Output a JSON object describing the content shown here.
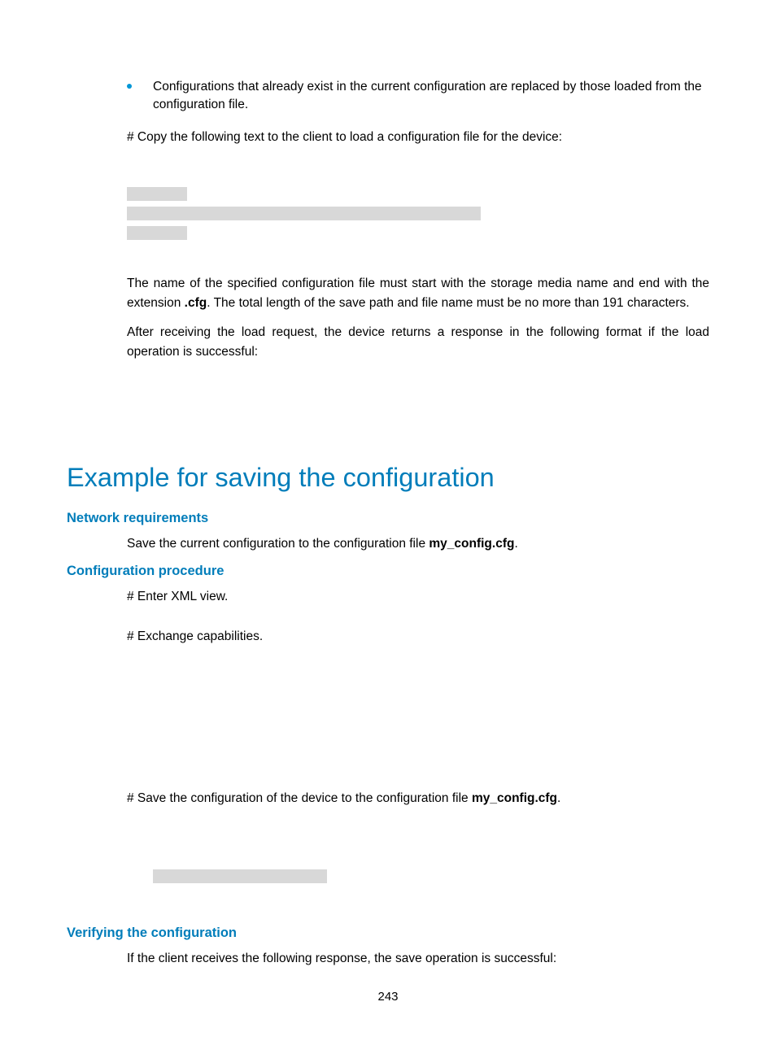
{
  "bullet": "Configurations that already exist in the current configuration are replaced by those loaded from the configuration file.",
  "copy_text": "# Copy the following text to the client to load a configuration file for the device:",
  "para_name_1": "The name of the specified configuration file must start with the storage media name and end with the extension ",
  "cfg_ext": ".cfg",
  "para_name_2": ". The total length of the save path and file name must be no more than 191 characters.",
  "para_after": "After receiving the load request, the device returns a response in the following format if the load operation is successful:",
  "heading_main": "Example for saving the configuration",
  "sub1": "Network requirements",
  "sub1_text_a": "Save the current configuration to the configuration file ",
  "sub1_file": "my_config.cfg",
  "sub2": "Configuration procedure",
  "step1": "# Enter XML view.",
  "step2": "# Exchange capabilities.",
  "step3_a": "# Save the configuration of the device to the configuration file ",
  "step3_file": "my_config.cfg",
  "sub3": "Verifying the configuration",
  "sub3_text": "If the client receives the following response, the save operation is successful:",
  "page_num": "243"
}
